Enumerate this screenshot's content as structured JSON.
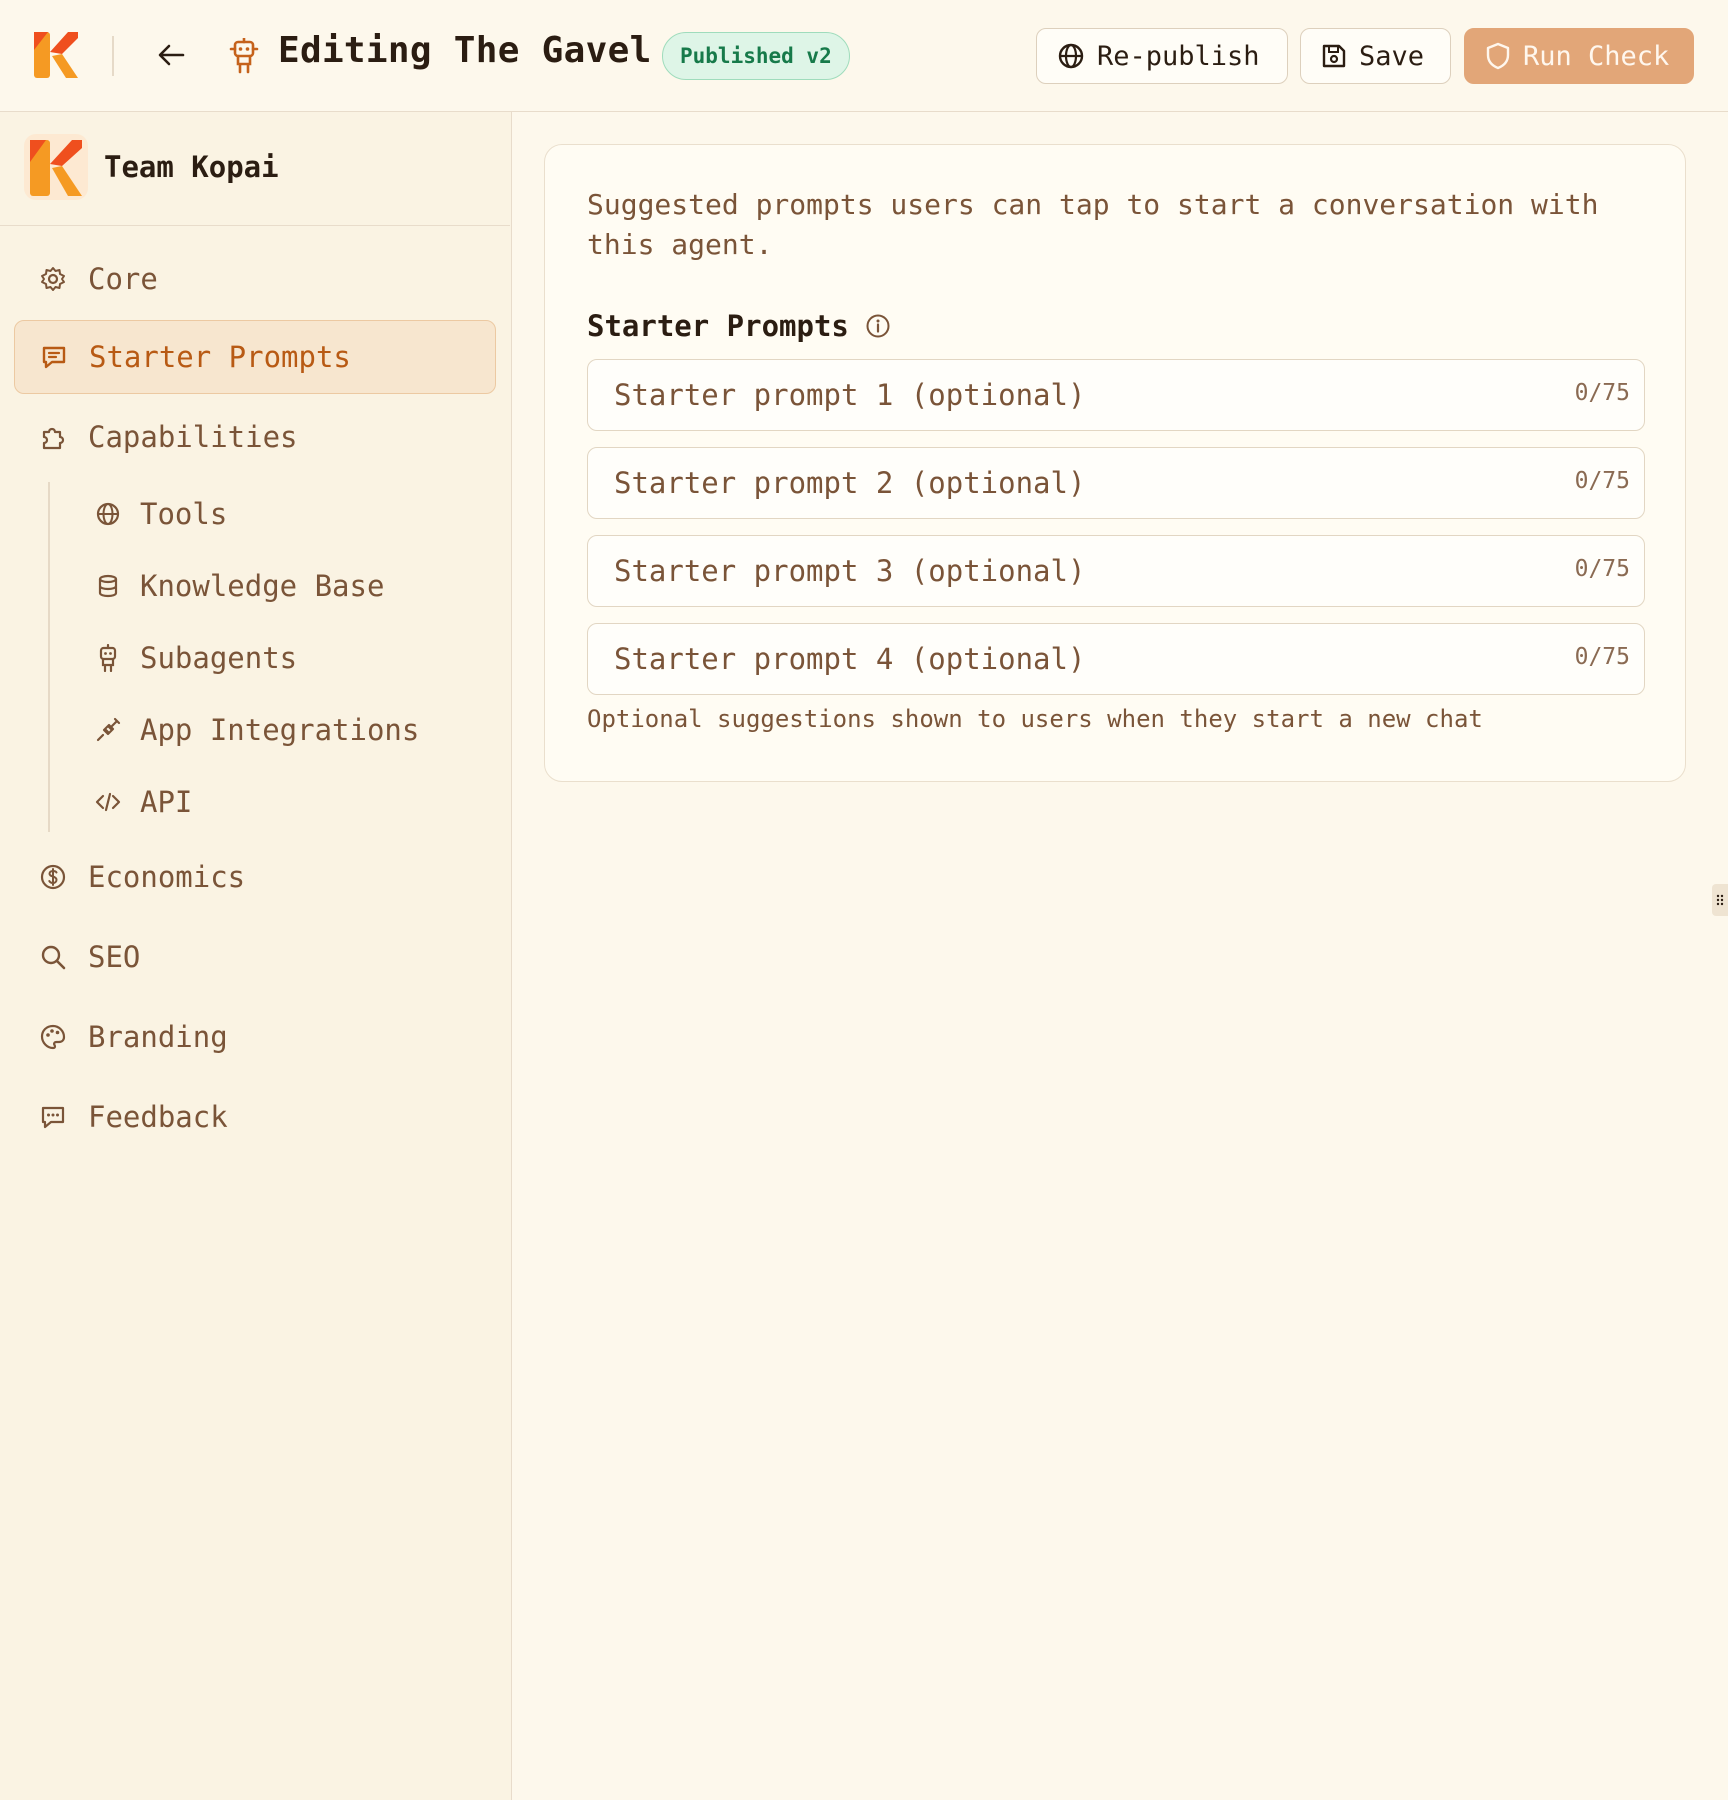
{
  "header": {
    "title": "Editing The Gavel",
    "status_badge": "Published v2",
    "buttons": {
      "republish": "Re-publish",
      "save": "Save",
      "run_check": "Run Check"
    }
  },
  "sidebar": {
    "team_name": "Team Kopai",
    "nav": {
      "core": "Core",
      "starter_prompts": "Starter Prompts",
      "capabilities": "Capabilities",
      "economics": "Economics",
      "seo": "SEO",
      "branding": "Branding",
      "feedback": "Feedback"
    },
    "capabilities_sub": {
      "tools": "Tools",
      "knowledge_base": "Knowledge Base",
      "subagents": "Subagents",
      "app_integrations": "App Integrations",
      "api": "API"
    },
    "active_item": "Starter Prompts"
  },
  "main": {
    "description": "Suggested prompts users can tap to start a conversation with this agent.",
    "section_label": "Starter Prompts",
    "prompts": [
      {
        "placeholder": "Starter prompt 1 (optional)",
        "value": "",
        "counter": "0/75"
      },
      {
        "placeholder": "Starter prompt 2 (optional)",
        "value": "",
        "counter": "0/75"
      },
      {
        "placeholder": "Starter prompt 3 (optional)",
        "value": "",
        "counter": "0/75"
      },
      {
        "placeholder": "Starter prompt 4 (optional)",
        "value": "",
        "counter": "0/75"
      }
    ],
    "help_text": "Optional suggestions shown to users when they start a new chat"
  },
  "colors": {
    "accent": "#b85a14",
    "brand_orange": "#f59a23",
    "brand_red": "#ef4f1e",
    "status_green": "#177a4a",
    "run_check_bg": "#e2a678",
    "background": "#fdf8ec"
  },
  "icons": {
    "republish": "globe-icon",
    "save": "save-icon",
    "run_check": "shield-icon",
    "back": "arrow-left-icon",
    "agent": "robot-icon",
    "info": "info-icon"
  }
}
